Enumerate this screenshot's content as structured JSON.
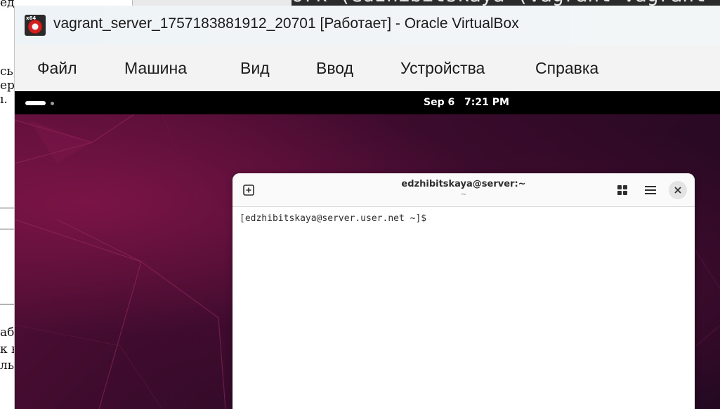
{
  "background_doc": {
    "fragments": [
      "едова",
      "сь,",
      "ери",
      "ı.",
      "аб",
      "к в",
      "ль"
    ]
  },
  "background_terminal": {
    "peek_text": "ork (edzhibitskaya (vagrant-vagrant"
  },
  "window": {
    "title": "vagrant_server_1757183881912_20701 [Работает] - Oracle VirtualBox",
    "icon": "virtualbox-icon",
    "icon_badge": "x64"
  },
  "menubar": {
    "items": [
      {
        "label": "Файл"
      },
      {
        "label": "Машина"
      },
      {
        "label": "Вид"
      },
      {
        "label": "Ввод"
      },
      {
        "label": "Устройства"
      },
      {
        "label": "Справка"
      }
    ]
  },
  "guest": {
    "topbar": {
      "date": "Sep 6",
      "time": "7:21 PM"
    },
    "terminal": {
      "title": "edzhibitskaya@server:~",
      "subtitle": "~",
      "prompt": "[edzhibitskaya@server.user.net ~]$",
      "icons": {
        "new_tab": "new-tab-icon",
        "view": "grid-icon",
        "menu": "hamburger-menu-icon",
        "close": "close-icon"
      }
    }
  },
  "colors": {
    "wallpaper_dark": "#2a0924",
    "wallpaper_accent": "#7a1446",
    "topbar": "#000000"
  }
}
